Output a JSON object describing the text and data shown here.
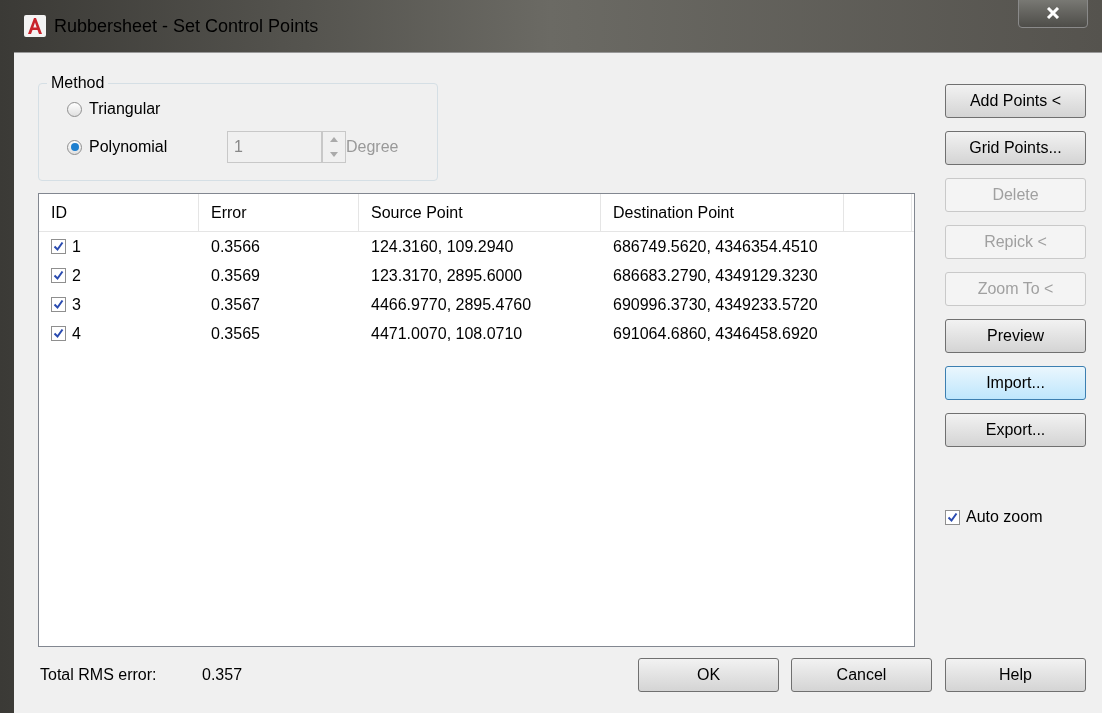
{
  "window": {
    "title": "Rubbersheet - Set Control Points"
  },
  "method": {
    "label": "Method",
    "options": [
      {
        "label": "Triangular",
        "selected": false
      },
      {
        "label": "Polynomial",
        "selected": true
      }
    ],
    "degree": {
      "value": "1",
      "label": "Degree",
      "disabled": true
    }
  },
  "table": {
    "columns": [
      "ID",
      "Error",
      "Source Point",
      "Destination Point"
    ],
    "rows": [
      {
        "checked": true,
        "id": "1",
        "error": "0.3566",
        "source": "124.3160, 109.2940",
        "destination": "686749.5620, 4346354.4510"
      },
      {
        "checked": true,
        "id": "2",
        "error": "0.3569",
        "source": "123.3170, 2895.6000",
        "destination": "686683.2790, 4349129.3230"
      },
      {
        "checked": true,
        "id": "3",
        "error": "0.3567",
        "source": "4466.9770, 2895.4760",
        "destination": "690996.3730, 4349233.5720"
      },
      {
        "checked": true,
        "id": "4",
        "error": "0.3565",
        "source": "4471.0070, 108.0710",
        "destination": "691064.6860, 4346458.6920"
      }
    ]
  },
  "side_buttons": [
    {
      "label": "Add Points <",
      "disabled": false,
      "focused": false
    },
    {
      "label": "Grid Points...",
      "disabled": false,
      "focused": false
    },
    {
      "label": "Delete",
      "disabled": true,
      "focused": false
    },
    {
      "label": "Repick <",
      "disabled": true,
      "focused": false
    },
    {
      "label": "Zoom To <",
      "disabled": true,
      "focused": false
    },
    {
      "label": "Preview",
      "disabled": false,
      "focused": false
    },
    {
      "label": "Import...",
      "disabled": false,
      "focused": true
    },
    {
      "label": "Export...",
      "disabled": false,
      "focused": false
    }
  ],
  "auto_zoom": {
    "label": "Auto zoom",
    "checked": true
  },
  "total_rms": {
    "label": "Total RMS error:",
    "value": "0.357"
  },
  "footer_buttons": [
    "OK",
    "Cancel",
    "Help"
  ]
}
